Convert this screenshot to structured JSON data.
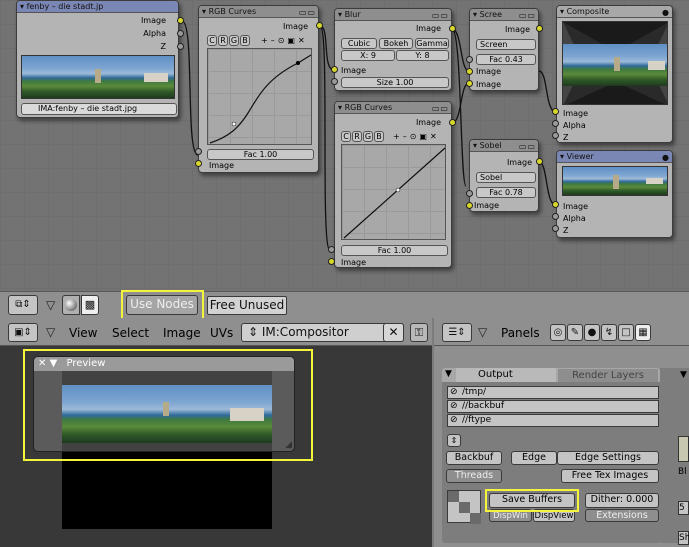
{
  "image_node": {
    "title": "fenby – die stadt.jp",
    "outputs": [
      "Image",
      "Alpha",
      "Z"
    ],
    "file": "IMA:fenby – die stadt.jpg"
  },
  "curves1": {
    "title": "RGB Curves",
    "tabs": [
      "C",
      "R",
      "G",
      "B"
    ],
    "tools": [
      "+",
      "–",
      "⊙",
      "▣",
      "✕"
    ],
    "output": "Image",
    "fac": "Fac 1.00",
    "input": "Image"
  },
  "blur": {
    "title": "Blur",
    "output": "Image",
    "opts": [
      "Cubic",
      "Bokeh",
      "Gamma"
    ],
    "x": "X: 9",
    "y": "Y: 8",
    "input": "Image",
    "size": "Size 1.00"
  },
  "screen": {
    "title": "Scree",
    "output": "Image",
    "mode": "Screen",
    "fac": "Fac 0.43",
    "in1": "Image",
    "in2": "Image"
  },
  "curves2": {
    "title": "RGB Curves",
    "tabs": [
      "C",
      "R",
      "G",
      "B"
    ],
    "tools": [
      "+",
      "–",
      "⊙",
      "▣",
      "✕"
    ],
    "output": "Image",
    "fac": "Fac 1.00",
    "input": "Image"
  },
  "sobel": {
    "title": "Sobel",
    "output": "Image",
    "mode": "Sobel",
    "fac": "Fac 0.78",
    "input": "Image"
  },
  "composite": {
    "title": "Composite",
    "inputs": [
      "Image",
      "Alpha",
      "Z"
    ]
  },
  "viewer": {
    "title": "Viewer",
    "inputs": [
      "Image",
      "Alpha",
      "Z"
    ]
  },
  "toolbar": {
    "use_nodes": "Use Nodes",
    "free_unused": "Free Unused"
  },
  "image_header": {
    "menus": [
      "View",
      "Select",
      "Image",
      "UVs"
    ],
    "image_name": "IM:Compositor",
    "close": "✕"
  },
  "preview": {
    "title": "Preview"
  },
  "panels": {
    "label": "Panels",
    "tab_output": "Output",
    "tab_render_layers": "Render Layers",
    "paths": [
      "/tmp/",
      "//backbuf",
      "//ftype"
    ],
    "buttons": {
      "backbuf": "Backbuf",
      "edge": "Edge",
      "edge_settings": "Edge Settings",
      "threads": "Threads",
      "free_tex": "Free Tex Images",
      "save_buffers": "Save Buffers",
      "dither": "Dither: 0.000",
      "dispwin": "DispWin",
      "dispview": "DispView",
      "extensions": "Extensions"
    },
    "right_cut": [
      "Bl",
      "5",
      "Sh"
    ]
  }
}
